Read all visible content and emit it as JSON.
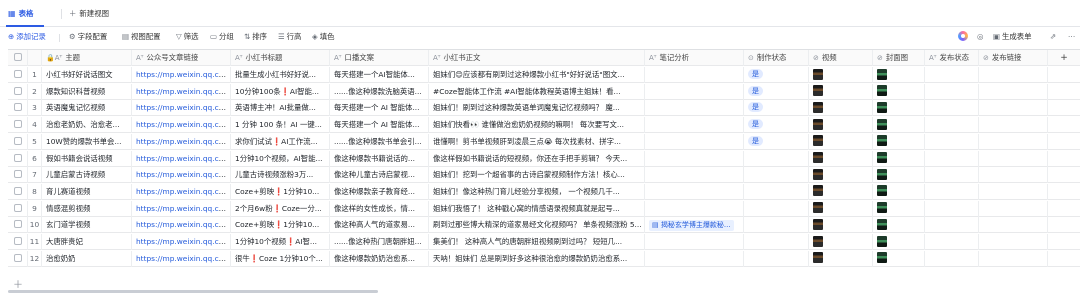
{
  "tabs": {
    "active_label": "表格",
    "new_view_label": "新建视图"
  },
  "toolbar": {
    "add_record": "添加记录",
    "field_config": "字段配置",
    "view_config": "视图配置",
    "filter": "筛选",
    "group": "分组",
    "sort": "排序",
    "row_height": "行高",
    "fill_color": "填色",
    "generate_form": "生成表单"
  },
  "columns": [
    {
      "label": "主题",
      "icon": "text-lock-icon"
    },
    {
      "label": "公众号文章链接",
      "icon": "text-icon"
    },
    {
      "label": "小红书标题",
      "icon": "text-icon"
    },
    {
      "label": "口播文案",
      "icon": "text-icon"
    },
    {
      "label": "小红书正文",
      "icon": "text-icon"
    },
    {
      "label": "笔记分析",
      "icon": "text-icon"
    },
    {
      "label": "制作状态",
      "icon": "status-icon"
    },
    {
      "label": "视频",
      "icon": "attachment-icon"
    },
    {
      "label": "封面图",
      "icon": "attachment-icon"
    },
    {
      "label": "发布状态",
      "icon": "text-icon"
    },
    {
      "label": "发布链接",
      "icon": "link-icon"
    }
  ],
  "rows": [
    {
      "num": "1",
      "theme": "小红书好好说话图文",
      "link": "https://mp.weixin.qq.co...",
      "title": "批量生成小红书好好说...",
      "copy": "每天搭建一个AI智能体...",
      "body": "姐妹们😊应该都有刷到过这种爆款小红书\"好好说话\"图文...",
      "analysis": "",
      "status": "是",
      "video": "dark",
      "cover": "green",
      "pub_status": "",
      "pub_link": ""
    },
    {
      "num": "2",
      "theme": "爆款知识科普视频",
      "link": "https://mp.weixin.qq.co...",
      "title": "10分钟100条❗AI智能...",
      "copy": "......像这种爆款洗脑英语...",
      "body": "#Coze智能体工作流 #AI智能体教程英语博主姐妹！看...",
      "analysis": "",
      "status": "是",
      "video": "dark",
      "cover": "green",
      "pub_status": "",
      "pub_link": ""
    },
    {
      "num": "3",
      "theme": "英语魔鬼记忆视频",
      "link": "https://mp.weixin.qq.co...",
      "title": "英语博主冲！AI批量做...",
      "copy": "每天搭建一个 AI 智能体...",
      "body": "姐妹们！刷到过这种爆款英语单词魔鬼记忆视频吗？ 魔...",
      "analysis": "",
      "status": "是",
      "video": "dark",
      "cover": "green",
      "pub_status": "",
      "pub_link": ""
    },
    {
      "num": "4",
      "theme": "治愈老奶奶、治愈老...",
      "link": "https://mp.weixin.qq.co...",
      "title": "1 分钟 100 条！AI 一键...",
      "copy": "每天搭建一个 AI 智能体...",
      "body": "姐妹们快看👀 谁懂做治愈奶奶视频的嘛啊！ 每次要写文...",
      "analysis": "",
      "status": "是",
      "video": "dark",
      "cover": "green",
      "pub_status": "",
      "pub_link": ""
    },
    {
      "num": "5",
      "theme": "10W赞的爆款书单会...",
      "link": "https://mp.weixin.qq.co...",
      "title": "求你们试试❗AI工作流...",
      "copy": "......像这种爆款书单会引...",
      "body": "谁懂啊！剪书单视频肝到凌晨三点😭 每次找素材、拼字...",
      "analysis": "",
      "status": "是",
      "video": "dark",
      "cover": "green",
      "pub_status": "",
      "pub_link": ""
    },
    {
      "num": "6",
      "theme": "假如书籍会说话视频",
      "link": "https://mp.weixin.qq.co...",
      "title": "1分钟10个视频，AI智能...",
      "copy": "像这种爆款书籍说话的...",
      "body": "像这样假如书籍说话的短视频，你还在手把手剪辑？ 今天...",
      "analysis": "",
      "status": "",
      "video": "dark",
      "cover": "green",
      "pub_status": "",
      "pub_link": ""
    },
    {
      "num": "7",
      "theme": "儿童启蒙古诗视频",
      "link": "https://mp.weixin.qq.co...",
      "title": "儿童古诗视频涨粉3万...",
      "copy": "像这种儿童古诗启蒙视...",
      "body": "姐妹们！挖到一个超省事的古诗启蒙视频制作方法！核心...",
      "analysis": "",
      "status": "",
      "video": "dark",
      "cover": "green",
      "pub_status": "",
      "pub_link": ""
    },
    {
      "num": "8",
      "theme": "育儿赛道视频",
      "link": "https://mp.weixin.qq.co...",
      "title": "Coze+剪映❗1分钟10...",
      "copy": "像这种爆款亲子教育经...",
      "body": "姐妹们！像这种热门育儿经验分享视频， 一个视频几千...",
      "analysis": "",
      "status": "",
      "video": "dark",
      "cover": "green",
      "pub_status": "",
      "pub_link": ""
    },
    {
      "num": "9",
      "theme": "情感混剪视频",
      "link": "https://mp.weixin.qq.co...",
      "title": "2个月6w粉❗Coze一分...",
      "copy": "像这样的女性成长，情...",
      "body": "姐妹们我悟了！ 这种戳心窝的情感语录视频真就是起号...",
      "analysis": "",
      "status": "",
      "video": "dark",
      "cover": "green",
      "pub_status": "",
      "pub_link": ""
    },
    {
      "num": "10",
      "theme": "玄门道学视频",
      "link": "https://mp.weixin.qq.co...",
      "title": "Coze+剪映❗1分钟10...",
      "copy": "像这种高人气的道家易...",
      "body": "刷到过那些博大精深的道家易经文化视频吗？ 单条视频涨粉 5...",
      "analysis": "揭秘玄学博主爆款秘...",
      "status": "",
      "video": "dark",
      "cover": "green",
      "pub_status": "",
      "pub_link": ""
    },
    {
      "num": "11",
      "theme": "大唐胖贵妃",
      "link": "https://mp.weixin.qq.co...",
      "title": "1分钟10个视频❗AI智...",
      "copy": "......像这种热门唐朝胖妞...",
      "body": "集美们！ 这种高人气的唐朝胖妞视频刷到过吗？ 短短几...",
      "analysis": "",
      "status": "",
      "video": "dark",
      "cover": "green",
      "pub_status": "",
      "pub_link": ""
    },
    {
      "num": "12",
      "theme": "治愈奶奶",
      "link": "https://mp.weixin.qq.co...",
      "title": "很牛❗Coze 1分钟10个...",
      "copy": "像这种爆款奶奶治愈系...",
      "body": "天呐！姐妹们 总是刷到好多这种很治愈的爆款奶奶治愈系...",
      "analysis": "",
      "status": "",
      "video": "dark",
      "cover": "green",
      "pub_status": "",
      "pub_link": ""
    }
  ]
}
